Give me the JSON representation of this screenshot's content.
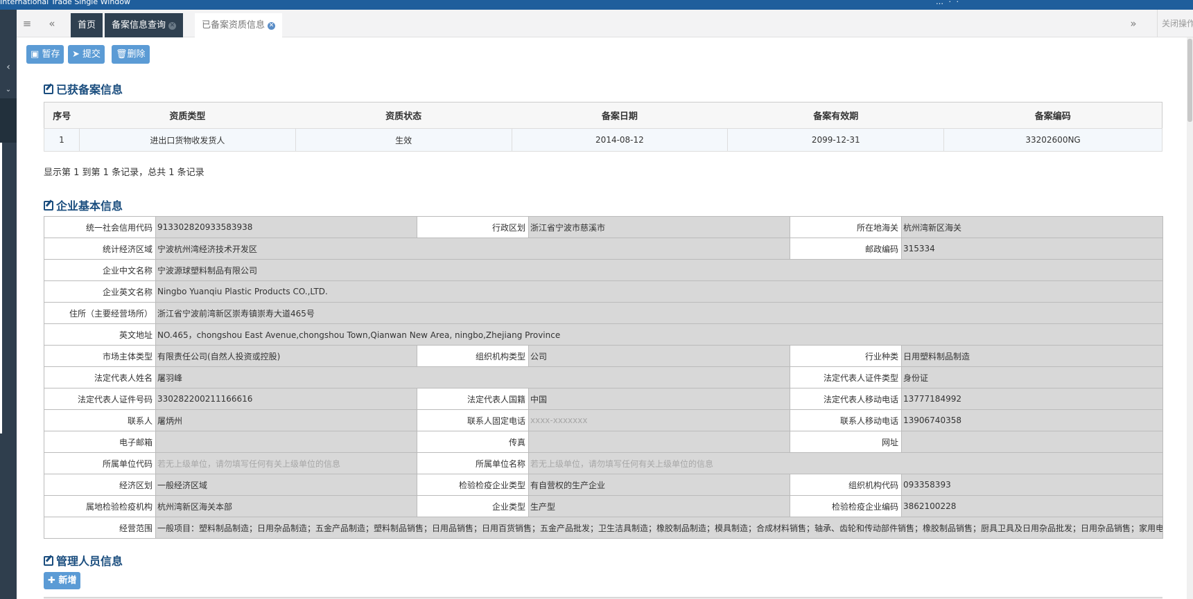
{
  "window": {
    "title": "International Trade Single Window",
    "right_text": "…  ·  ·"
  },
  "tabbar": {
    "tabs": [
      {
        "label": "首页"
      },
      {
        "label": "备案信息查询"
      },
      {
        "label": "已备案资质信息"
      }
    ],
    "close_ops": "关闭操作"
  },
  "toolbar": {
    "save": "暂存",
    "submit": "提交",
    "delete": "删除"
  },
  "sections": {
    "records_title": "已获备案信息",
    "basic_title": "企业基本信息",
    "managers_title": "管理人员信息"
  },
  "records": {
    "headers": [
      "序号",
      "资质类型",
      "资质状态",
      "备案日期",
      "备案有效期",
      "备案编码"
    ],
    "rows": [
      [
        "1",
        "进出口货物收发货人",
        "生效",
        "2014-08-12",
        "2099-12-31",
        "33202600NG"
      ]
    ],
    "pager": "显示第 1 到第 1 条记录，总共 1 条记录"
  },
  "basic": {
    "credit_code_label": "统一社会信用代码",
    "credit_code": "913302820933583938",
    "region_label": "行政区划",
    "region": "浙江省宁波市慈溪市",
    "customs_label": "所在地海关",
    "customs": "杭州湾新区海关",
    "econ_zone_label": "统计经济区域",
    "econ_zone": "宁波杭州湾经济技术开发区",
    "postcode_label": "邮政编码",
    "postcode": "315334",
    "cn_name_label": "企业中文名称",
    "cn_name": "宁波源球塑料制品有限公司",
    "en_name_label": "企业英文名称",
    "en_name": "Ningbo Yuanqiu Plastic Products CO.,LTD.",
    "address_label": "住所（主要经营场所）",
    "address": "浙江省宁波前湾新区崇寿镇崇寿大道465号",
    "en_address_label": "英文地址",
    "en_address": "NO.465，chongshou East Avenue,chongshou Town,Qianwan New Area, ningbo,Zhejiang Province",
    "market_type_label": "市场主体类型",
    "market_type": "有限责任公司(自然人投资或控股)",
    "org_type_label": "组织机构类型",
    "org_type": "公司",
    "industry_label": "行业种类",
    "industry": "日用塑料制品制造",
    "legal_name_label": "法定代表人姓名",
    "legal_name": "屠羽峰",
    "legal_id_type_label": "法定代表人证件类型",
    "legal_id_type": "身份证",
    "legal_id_no_label": "法定代表人证件号码",
    "legal_id_no": "330282200211166616",
    "legal_nation_label": "法定代表人国籍",
    "legal_nation": "中国",
    "legal_mobile_label": "法定代表人移动电话",
    "legal_mobile": "13777184992",
    "contact_label": "联系人",
    "contact": "屠炳州",
    "contact_phone_label": "联系人固定电话",
    "contact_phone": "xxxx-xxxxxxx",
    "contact_mobile_label": "联系人移动电话",
    "contact_mobile": "13906740358",
    "email_label": "电子邮箱",
    "email": "",
    "fax_label": "传真",
    "fax": "",
    "website_label": "网址",
    "website": "",
    "parent_code_label": "所属单位代码",
    "parent_code": "若无上级单位，请勿填写任何有关上级单位的信息",
    "parent_name_label": "所属单位名称",
    "parent_name": "若无上级单位，请勿填写任何有关上级单位的信息",
    "econ_region_label": "经济区划",
    "econ_region": "一般经济区域",
    "ciq_type_label": "检验检疫企业类型",
    "ciq_type": "有自营权的生产企业",
    "org_code_label": "组织机构代码",
    "org_code": "093358393",
    "ciq_org_label": "属地检验检疫机构",
    "ciq_org": "杭州湾新区海关本部",
    "ent_type_label": "企业类型",
    "ent_type": "生产型",
    "ciq_code_label": "检验检疫企业编码",
    "ciq_code": "3862100228",
    "scope_label": "经营范围",
    "scope": "一般项目：塑料制品制造；日用杂品制造；五金产品制造；塑料制品销售；日用品销售；日用百货销售；五金产品批发；卫生洁具制造；橡胶制品制造；模具制造；合成材料销售；轴承、齿轮和传动部件销售；橡胶制品销售；厨具卫具及日用杂品批发；日用杂品销售；家用电"
  },
  "managers": {
    "add": "新增"
  }
}
